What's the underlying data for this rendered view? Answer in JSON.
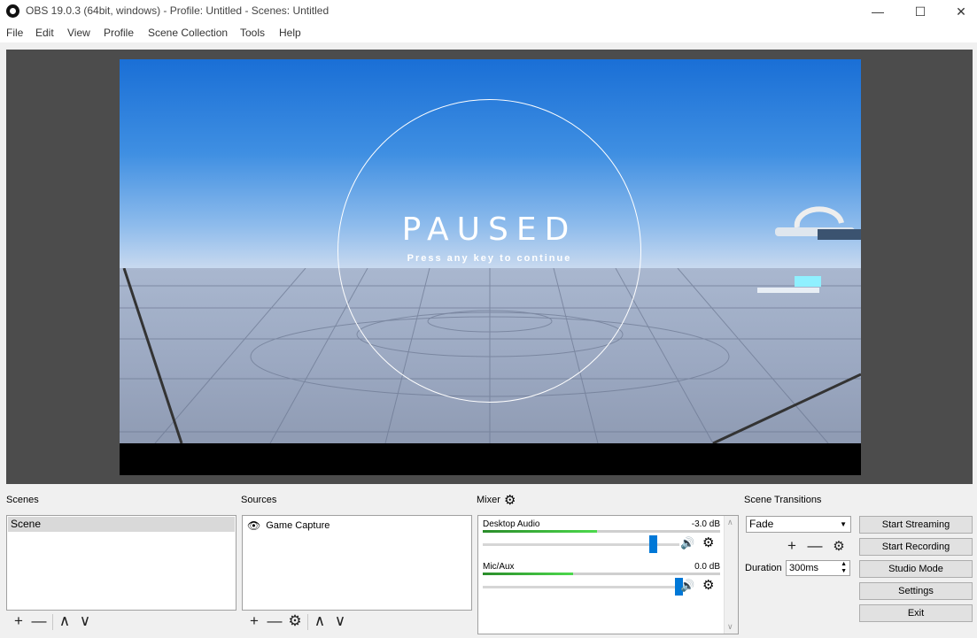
{
  "window": {
    "title": "OBS 19.0.3 (64bit, windows) - Profile: Untitled - Scenes: Untitled",
    "minimize": "—",
    "maximize": "☐",
    "close": "✕"
  },
  "menu": [
    "File",
    "Edit",
    "View",
    "Profile",
    "Scene Collection",
    "Tools",
    "Help"
  ],
  "preview": {
    "paused_title": "PAUSED",
    "paused_subtitle": "Press any key to continue"
  },
  "scenes": {
    "label": "Scenes",
    "items": [
      "Scene"
    ]
  },
  "sources": {
    "label": "Sources",
    "items": [
      "Game Capture"
    ]
  },
  "mixer": {
    "label": "Mixer",
    "channels": [
      {
        "name": "Desktop Audio",
        "db": "-3.0 dB",
        "level": 0.48,
        "volume": 0.87
      },
      {
        "name": "Mic/Aux",
        "db": "0.0 dB",
        "level": 0.38,
        "volume": 1.0
      }
    ]
  },
  "transitions": {
    "label": "Scene Transitions",
    "selected": "Fade",
    "duration_label": "Duration",
    "duration_value": "300ms"
  },
  "controls": {
    "start_streaming": "Start Streaming",
    "start_recording": "Start Recording",
    "studio_mode": "Studio Mode",
    "settings": "Settings",
    "exit": "Exit"
  },
  "icons": {
    "add": "+",
    "remove": "—",
    "up": "∧",
    "down": "∨",
    "gear": "⚙",
    "speaker": "🔊",
    "eye": "👁"
  }
}
